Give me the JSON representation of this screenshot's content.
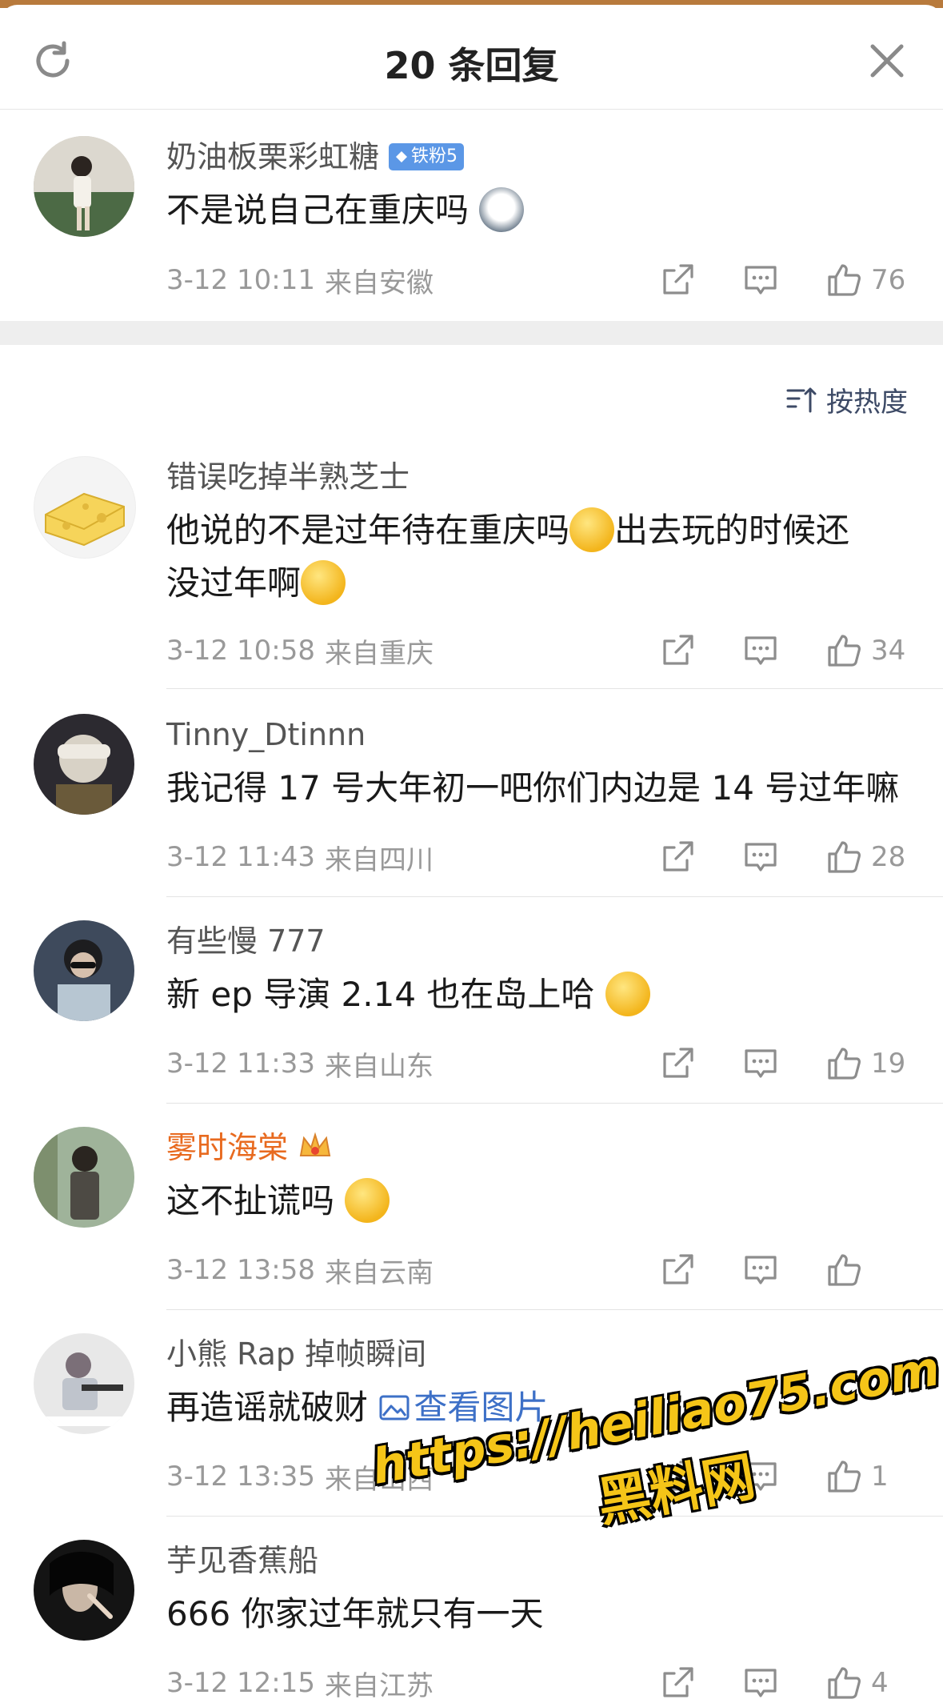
{
  "header": {
    "title": "20 条回复",
    "refresh_icon": "refresh-icon",
    "close_icon": "close-icon"
  },
  "top_comment": {
    "username": "奶油板栗彩虹糖",
    "badge": "铁粉5",
    "text": "不是说自己在重庆吗",
    "time": "3-12 10:11",
    "location": "来自安徽",
    "likes": "76"
  },
  "sort": {
    "label": "按热度"
  },
  "comments": [
    {
      "username": "错误吃掉半熟芝士",
      "text1": "他说的不是过年待在重庆吗",
      "text2": "出去玩的时候还",
      "text3": "没过年啊",
      "time": "3-12 10:58",
      "location": "来自重庆",
      "likes": "34"
    },
    {
      "username": "Tinny_Dtinnn",
      "text1": "我记得 17 号大年初一吧你们内边是 14 号过年嘛",
      "time": "3-12 11:43",
      "location": "来自四川",
      "likes": "28"
    },
    {
      "username": "有些慢 777",
      "text1": "新 ep 导演 2.14 也在岛上哈",
      "time": "3-12 11:33",
      "location": "来自山东",
      "likes": "19"
    },
    {
      "username": "雾时海棠",
      "text1": "这不扯谎吗",
      "time": "3-12 13:58",
      "location": "来自云南",
      "likes": ""
    },
    {
      "username": "小熊 Rap 掉帧瞬间",
      "text1": "再造谣就破财",
      "link": "查看图片",
      "time": "3-12 13:35",
      "location": "来自山西",
      "likes": "1"
    },
    {
      "username": "芋见香蕉船",
      "text1": "666 你家过年就只有一天",
      "time": "3-12 12:15",
      "location": "来自江苏",
      "likes": "4"
    }
  ],
  "watermark": {
    "url": "https://heiliao75.com",
    "name": "黑料网"
  },
  "colors": {
    "link": "#3d70c7",
    "vip_name": "#e86a1f",
    "badge_bg": "#5b97e6",
    "meta": "#999999"
  }
}
